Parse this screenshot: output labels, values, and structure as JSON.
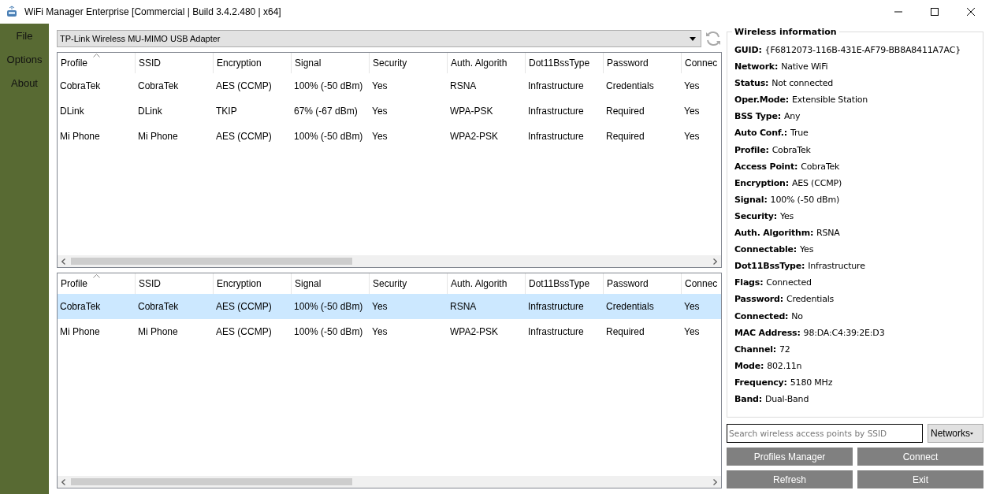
{
  "window": {
    "title": "WiFi Manager Enterprise [Commercial | Build 3.4.2.480 | x64]"
  },
  "sidebar": {
    "items": [
      {
        "label": "File"
      },
      {
        "label": "Options"
      },
      {
        "label": "About"
      }
    ]
  },
  "adapter": {
    "value": "TP-Link Wireless MU-MIMO USB Adapter"
  },
  "tables": [
    {
      "columns": [
        "Profile",
        "SSID",
        "Encryption",
        "Signal",
        "Security",
        "Auth. Algorith",
        "Dot11BssType",
        "Password",
        "Connec"
      ],
      "rows": [
        {
          "cells": [
            "CobraTek",
            "CobraTek",
            "AES (CCMP)",
            "100% (-50 dBm)",
            "Yes",
            "RSNA",
            "Infrastructure",
            "Credentials",
            "Yes"
          ],
          "selected": false
        },
        {
          "cells": [
            "DLink",
            "DLink",
            "TKIP",
            "67% (-67 dBm)",
            "Yes",
            "WPA-PSK",
            "Infrastructure",
            "Required",
            "Yes"
          ],
          "selected": false
        },
        {
          "cells": [
            "Mi Phone",
            "Mi Phone",
            "AES (CCMP)",
            "100% (-50 dBm)",
            "Yes",
            "WPA2-PSK",
            "Infrastructure",
            "Required",
            "Yes"
          ],
          "selected": false
        }
      ]
    },
    {
      "columns": [
        "Profile",
        "SSID",
        "Encryption",
        "Signal",
        "Security",
        "Auth. Algorith",
        "Dot11BssType",
        "Password",
        "Connec"
      ],
      "rows": [
        {
          "cells": [
            "CobraTek",
            "CobraTek",
            "AES (CCMP)",
            "100% (-50 dBm)",
            "Yes",
            "RSNA",
            "Infrastructure",
            "Credentials",
            "Yes"
          ],
          "selected": true
        },
        {
          "cells": [
            "Mi Phone",
            "Mi Phone",
            "AES (CCMP)",
            "100% (-50 dBm)",
            "Yes",
            "WPA2-PSK",
            "Infrastructure",
            "Required",
            "Yes"
          ],
          "selected": false
        }
      ]
    }
  ],
  "info": {
    "title": "Wireless information",
    "fields": [
      {
        "label": "GUID:",
        "value": "{F6812073-116B-431E-AF79-BB8A8411A7AC}"
      },
      {
        "label": "Network:",
        "value": "Native WiFi"
      },
      {
        "label": "Status:",
        "value": "Not connected"
      },
      {
        "label": "Oper.Mode:",
        "value": "Extensible Station"
      },
      {
        "label": "BSS Type:",
        "value": "Any"
      },
      {
        "label": "Auto Conf.:",
        "value": "True"
      },
      {
        "label": "Profile:",
        "value": "CobraTek"
      },
      {
        "label": "Access Point:",
        "value": "CobraTek"
      },
      {
        "label": "Encryption:",
        "value": "AES (CCMP)"
      },
      {
        "label": "Signal:",
        "value": "100% (-50 dBm)"
      },
      {
        "label": "Security:",
        "value": "Yes"
      },
      {
        "label": "Auth. Algorithm:",
        "value": "RSNA"
      },
      {
        "label": "Connectable:",
        "value": "Yes"
      },
      {
        "label": "Dot11BssType:",
        "value": "Infrastructure"
      },
      {
        "label": "Flags:",
        "value": "Connected"
      },
      {
        "label": "Password:",
        "value": "Credentials"
      },
      {
        "label": "Connected:",
        "value": "No"
      },
      {
        "label": "MAC Address:",
        "value": "98:DA:C4:39:2E:D3"
      },
      {
        "label": "Channel:",
        "value": "72"
      },
      {
        "label": "Mode:",
        "value": "802.11n"
      },
      {
        "label": "Frequency:",
        "value": "5180 MHz"
      },
      {
        "label": "Band:",
        "value": "Dual-Band"
      }
    ]
  },
  "search": {
    "placeholder": "Search wireless access points by SSID"
  },
  "filter": {
    "value": "Networks"
  },
  "buttons": [
    "Profiles Manager",
    "Connect",
    "Refresh",
    "Exit"
  ]
}
